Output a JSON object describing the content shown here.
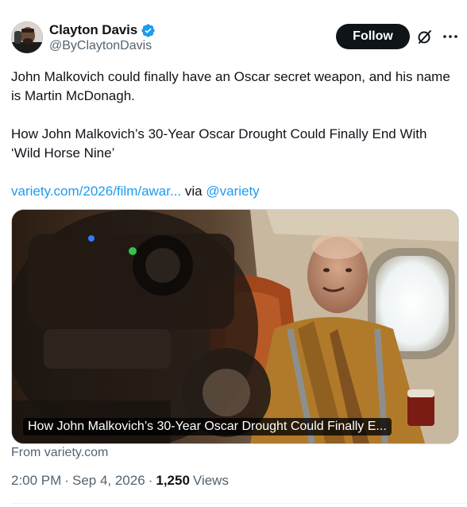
{
  "author": {
    "display_name": "Clayton Davis",
    "handle": "@ByClaytonDavis",
    "verified": true
  },
  "actions": {
    "follow_label": "Follow"
  },
  "tweet": {
    "paragraph_1": "John Malkovich could finally have an Oscar secret weapon, and his name is Martin McDonagh.",
    "paragraph_2": "How John Malkovich’s 30-Year Oscar Drought Could Finally End With ‘Wild Horse Nine’",
    "link_text": "variety.com/2026/film/awar...",
    "via_text": " via ",
    "mention": "@variety"
  },
  "card": {
    "title": "How John Malkovich’s 30-Year Oscar Drought Could Finally E..."
  },
  "source": {
    "from_text": "From variety.com"
  },
  "meta": {
    "time": "2:00 PM",
    "separator": "·",
    "date": "Sep 4, 2026",
    "views_count": "1,250",
    "views_label": "Views"
  },
  "colors": {
    "accent": "#1d9bf0",
    "text_primary": "#0f1419",
    "text_secondary": "#536471",
    "follow_bg": "#0f1419"
  },
  "icons": {
    "verified": "verified-badge-icon",
    "grok": "grok-icon",
    "more": "more-options-icon"
  }
}
